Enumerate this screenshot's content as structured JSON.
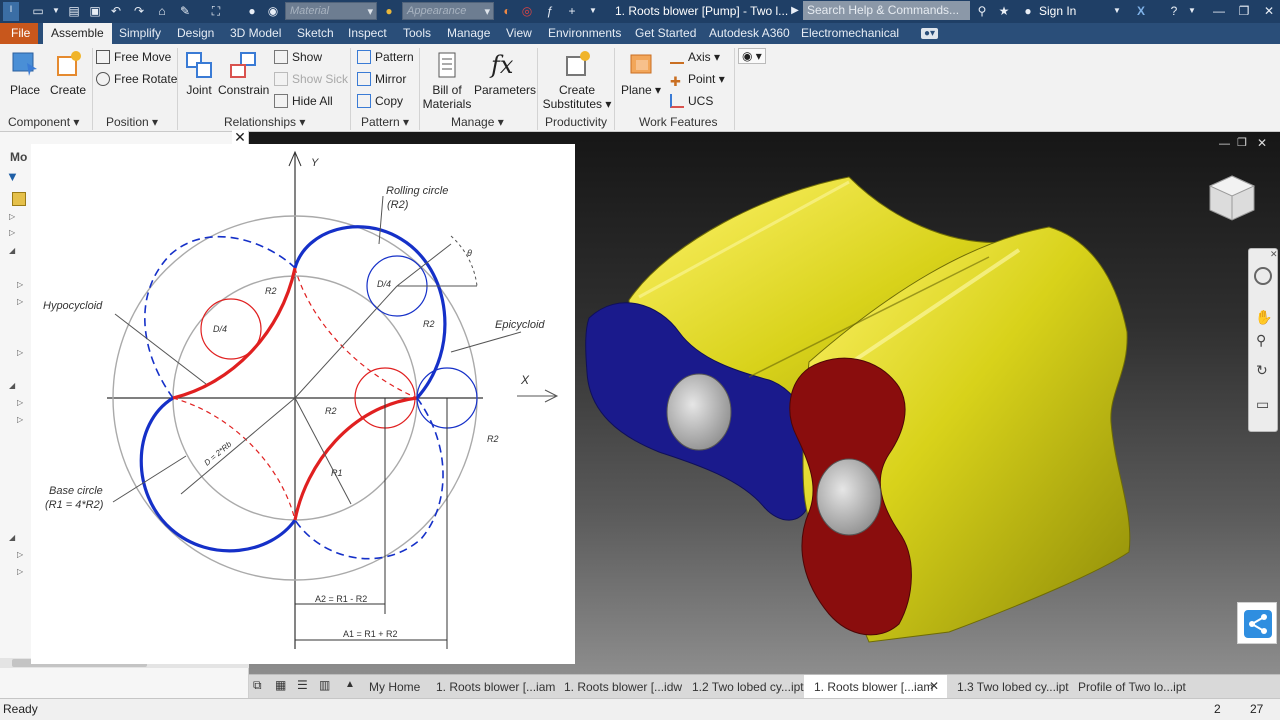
{
  "titlebar": {
    "material_placeholder": "Material",
    "appearance_placeholder": "Appearance",
    "title": "1. Roots blower [Pump] - Two l...",
    "search_placeholder": "Search Help & Commands...",
    "signin": "Sign In"
  },
  "menu": {
    "file": "File",
    "tabs": [
      "Assemble",
      "Simplify",
      "Design",
      "3D Model",
      "Sketch",
      "Inspect",
      "Tools",
      "Manage",
      "View",
      "Environments",
      "Get Started",
      "Autodesk A360",
      "Electromechanical"
    ]
  },
  "ribbon": {
    "component": {
      "place": "Place",
      "create": "Create",
      "label": "Component"
    },
    "position": {
      "free_move": "Free Move",
      "free_rotate": "Free Rotate",
      "label": "Position"
    },
    "relationships": {
      "joint": "Joint",
      "constrain": "Constrain",
      "show": "Show",
      "show_sick": "Show Sick",
      "hide_all": "Hide All",
      "label": "Relationships"
    },
    "pattern": {
      "pattern": "Pattern",
      "mirror": "Mirror",
      "copy": "Copy",
      "label": "Pattern"
    },
    "manage": {
      "bom_line1": "Bill of",
      "bom_line2": "Materials",
      "parameters": "Parameters",
      "label": "Manage"
    },
    "productivity": {
      "line1": "Create",
      "line2": "Substitutes",
      "label": "Productivity"
    },
    "work_features": {
      "plane": "Plane",
      "axis": "Axis",
      "point": "Point",
      "ucs": "UCS",
      "label": "Work Features"
    }
  },
  "browser": {
    "header": "Mo"
  },
  "diagram": {
    "y_axis": "Y",
    "x_axis": "X",
    "rolling_circle": "Rolling circle",
    "rolling_circle_sub": "(R2)",
    "hypocycloid": "Hypocycloid",
    "epicycloid": "Epicycloid",
    "base_circle": "Base circle",
    "base_circle_sub": "(R1 = 4*R2)",
    "d4": "D/4",
    "r2": "R2",
    "r1": "R1",
    "theta": "θ",
    "diameter": "D = 2*Rb",
    "a2": "A2 = R1 - R2",
    "a1": "A1 = R1 + R2"
  },
  "doc_tabs": {
    "my_home": "My Home",
    "tabs": [
      "1. Roots blower [...iam",
      "1. Roots blower [...idw",
      "1.2 Two lobed cy...ipt",
      "1. Roots blower [...iam",
      "1.3 Two lobed cy...ipt",
      "Profile of Two lo...ipt"
    ],
    "active_index": 3
  },
  "status": {
    "text": "Ready",
    "count1": "2",
    "count2": "27"
  },
  "colors": {
    "titlebar": "#1f3f66",
    "file_tab": "#c8571c",
    "lobe_yellow": "#e5e21a",
    "blue_face": "#1a1a8c",
    "red_face": "#8a0d0d",
    "blue_curve": "#1530c8",
    "red_curve": "#e02020"
  }
}
